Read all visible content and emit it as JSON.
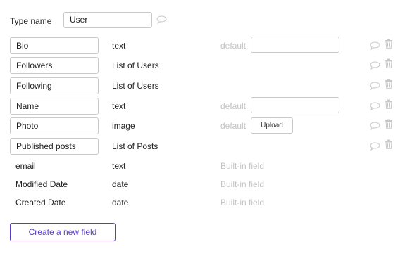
{
  "type_name": {
    "label": "Type name",
    "value": "User"
  },
  "fields": [
    {
      "name": "Bio",
      "type": "text",
      "default_label": "default",
      "default_value": ""
    },
    {
      "name": "Followers",
      "type": "List of Users"
    },
    {
      "name": "Following",
      "type": "List of Users"
    },
    {
      "name": "Name",
      "type": "text",
      "default_label": "default",
      "default_value": ""
    },
    {
      "name": "Photo",
      "type": "image",
      "default_label": "default",
      "upload_label": "Upload"
    },
    {
      "name": "Published posts",
      "type": "List of Posts"
    }
  ],
  "builtin_fields": [
    {
      "name": "email",
      "type": "text",
      "note": "Built-in field"
    },
    {
      "name": "Modified Date",
      "type": "date",
      "note": "Built-in field"
    },
    {
      "name": "Created Date",
      "type": "date",
      "note": "Built-in field"
    }
  ],
  "create_button": {
    "label": "Create a new field"
  },
  "icons": {
    "comment": "speech-bubble-icon",
    "delete": "trash-icon"
  },
  "colors": {
    "accent": "#5b3ec8",
    "muted_text": "#c4c4c4",
    "icon": "#c8c8c8",
    "border": "#c9c9c9"
  }
}
